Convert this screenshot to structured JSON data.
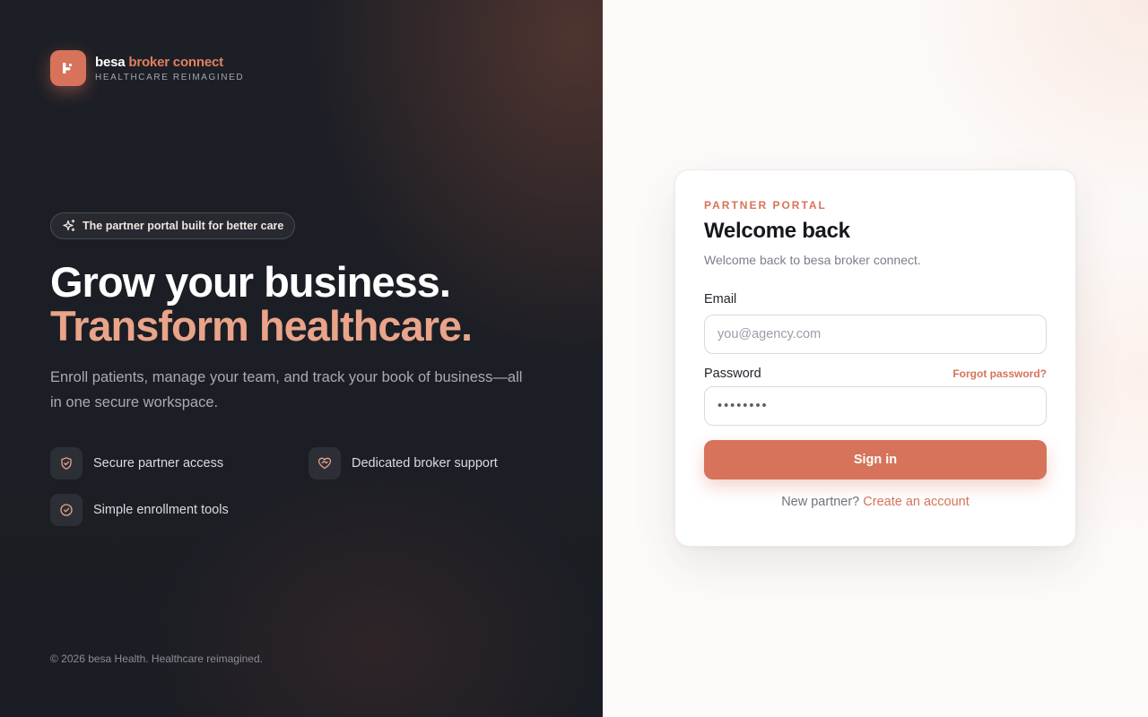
{
  "brand": {
    "name_part1": "besa",
    "name_part2": "broker connect",
    "tagline": "HEALTHCARE REIMAGINED",
    "logo_icon": "besa-logo-icon",
    "accent_color": "#d6735a"
  },
  "hero": {
    "pill_icon": "sparkle-icon",
    "pill_text": "The partner portal built for better care",
    "headline_line1": "Grow your business.",
    "headline_line2": "Transform healthcare.",
    "description": "Enroll patients, manage your team, and track your book of business—all in one secure workspace."
  },
  "features": [
    {
      "icon": "shield-icon",
      "label": "Secure partner access"
    },
    {
      "icon": "heart-handshake-icon",
      "label": "Dedicated broker support"
    },
    {
      "icon": "check-circle-icon",
      "label": "Simple enrollment tools"
    }
  ],
  "footer": {
    "copyright": "© 2026 besa Health. Healthcare reimagined."
  },
  "login": {
    "eyebrow": "PARTNER PORTAL",
    "title": "Welcome back",
    "subtitle": "Welcome back to besa broker connect.",
    "email_label": "Email",
    "email_placeholder": "you@agency.com",
    "email_value": "",
    "password_label": "Password",
    "forgot_link": "Forgot password?",
    "password_value": "••••••••",
    "submit_label": "Sign in",
    "signup_prompt": "New partner?",
    "signup_link": "Create an account"
  }
}
